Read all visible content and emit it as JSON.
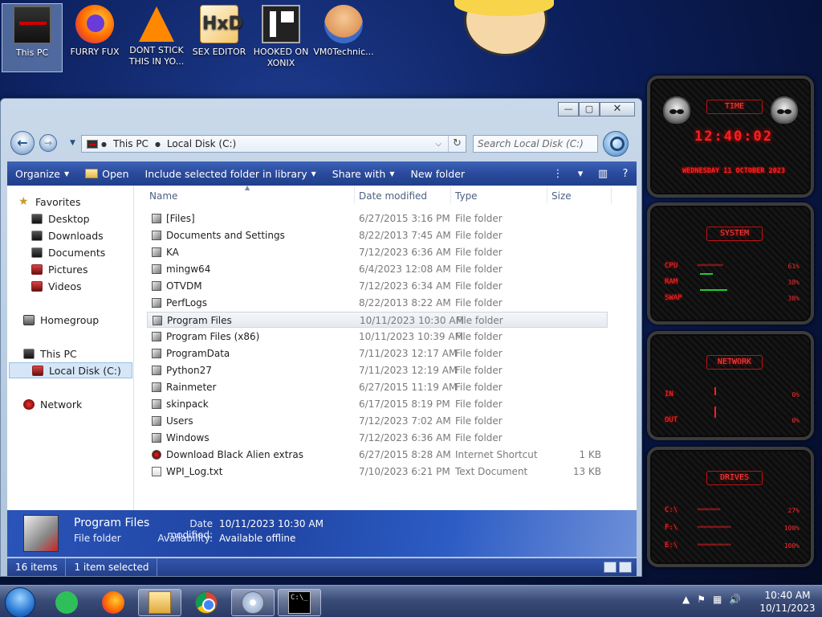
{
  "desktop": {
    "icons": [
      {
        "label": "This PC",
        "icon": "computer-icon"
      },
      {
        "label": "FURRY FUX",
        "icon": "firefox-icon"
      },
      {
        "label": "DONT STICK THIS IN YO...",
        "icon": "vlc-icon"
      },
      {
        "label": "SEX EDITOR",
        "icon": "hxd-icon"
      },
      {
        "label": "HOOKED ON XONIX",
        "icon": "xonix-icon"
      },
      {
        "label": "VM0Technic...",
        "icon": "technician-icon"
      }
    ]
  },
  "explorer": {
    "window_buttons": {
      "minimize": "—",
      "maximize": "▢",
      "close": "✕"
    },
    "address": {
      "crumbs": [
        "This PC",
        "Local Disk (C:)"
      ],
      "search_placeholder": "Search Local Disk (C:)"
    },
    "toolbar": {
      "organize": "Organize",
      "open": "Open",
      "include_library": "Include selected folder in library",
      "share_with": "Share with",
      "new_folder": "New folder"
    },
    "nav": {
      "favorites": "Favorites",
      "desktop": "Desktop",
      "downloads": "Downloads",
      "documents": "Documents",
      "pictures": "Pictures",
      "videos": "Videos",
      "homegroup": "Homegroup",
      "this_pc": "This PC",
      "local_disk": "Local Disk (C:)",
      "network": "Network"
    },
    "columns": {
      "name": "Name",
      "date": "Date modified",
      "type": "Type",
      "size": "Size"
    },
    "files": [
      {
        "name": "[Files]",
        "date": "6/27/2015 3:16 PM",
        "type": "File folder",
        "size": ""
      },
      {
        "name": "Documents and Settings",
        "date": "8/22/2013 7:45 AM",
        "type": "File folder",
        "size": ""
      },
      {
        "name": "KA",
        "date": "7/12/2023 6:36 AM",
        "type": "File folder",
        "size": ""
      },
      {
        "name": "mingw64",
        "date": "6/4/2023 12:08 AM",
        "type": "File folder",
        "size": ""
      },
      {
        "name": "OTVDM",
        "date": "7/12/2023 6:34 AM",
        "type": "File folder",
        "size": ""
      },
      {
        "name": "PerfLogs",
        "date": "8/22/2013 8:22 AM",
        "type": "File folder",
        "size": ""
      },
      {
        "name": "Program Files",
        "date": "10/11/2023 10:30 AM",
        "type": "File folder",
        "size": ""
      },
      {
        "name": "Program Files (x86)",
        "date": "10/11/2023 10:39 AM",
        "type": "File folder",
        "size": ""
      },
      {
        "name": "ProgramData",
        "date": "7/11/2023 12:17 AM",
        "type": "File folder",
        "size": ""
      },
      {
        "name": "Python27",
        "date": "7/11/2023 12:19 AM",
        "type": "File folder",
        "size": ""
      },
      {
        "name": "Rainmeter",
        "date": "6/27/2015 11:19 AM",
        "type": "File folder",
        "size": ""
      },
      {
        "name": "skinpack",
        "date": "6/17/2015 8:19 PM",
        "type": "File folder",
        "size": ""
      },
      {
        "name": "Users",
        "date": "7/12/2023 7:02 AM",
        "type": "File folder",
        "size": ""
      },
      {
        "name": "Windows",
        "date": "7/12/2023 6:36 AM",
        "type": "File folder",
        "size": ""
      },
      {
        "name": "Download Black Alien extras",
        "date": "6/27/2015 8:28 AM",
        "type": "Internet Shortcut",
        "size": "1 KB"
      },
      {
        "name": "WPI_Log.txt",
        "date": "7/10/2023 6:21 PM",
        "type": "Text Document",
        "size": "13 KB"
      }
    ],
    "details": {
      "name": "Program Files",
      "type": "File folder",
      "date_label": "Date modified:",
      "date_value": "10/11/2023 10:30 AM",
      "avail_label": "Availability:",
      "avail_value": "Available offline"
    },
    "status": {
      "items": "16 items",
      "selected": "1 item selected"
    }
  },
  "rainmeter": {
    "time_title": "TIME",
    "clock": "12:40:02",
    "date": "WEDNESDAY 11 OCTOBER 2023",
    "system_title": "SYSTEM",
    "cpu_label": "CPU",
    "cpu_value": "61%",
    "ram_label": "RAM",
    "ram_value": "38%",
    "swap_label": "SWAP",
    "swap_value": "38%",
    "network_title": "NETWORK",
    "in_label": "IN",
    "in_value": "0%",
    "out_label": "OUT",
    "out_value": "0%",
    "drives_title": "DRIVES",
    "drive_c": "C:\\",
    "drive_c_value": "27%",
    "drive_f": "F:\\",
    "drive_f_value": "100%",
    "drive_e": "E:\\",
    "drive_e_value": "100%"
  },
  "taskbar": {
    "pinned": [
      "start-orb-icon",
      "green-app-icon",
      "firefox-icon",
      "file-explorer-icon",
      "chrome-icon",
      "disc-app-icon",
      "command-prompt-icon"
    ],
    "cmd_text": "C:\\_",
    "clock_time": "10:40 AM",
    "clock_date": "10/11/2023"
  }
}
